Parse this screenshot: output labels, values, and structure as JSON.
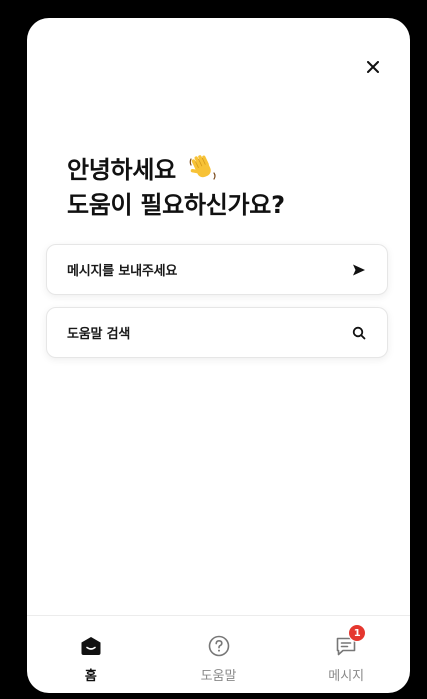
{
  "greeting": {
    "line1": "안녕하세요",
    "line2": "도움이 필요하신가요?",
    "emoji_icon": "waving-hand-icon"
  },
  "actions": {
    "send_message": {
      "label": "메시지를 보내주세요",
      "icon": "send-arrow-icon"
    },
    "search_help": {
      "label": "도움말 검색",
      "icon": "search-icon"
    }
  },
  "close": {
    "icon": "close-icon"
  },
  "nav": {
    "home": {
      "label": "홈",
      "icon": "home-icon",
      "active": true
    },
    "help": {
      "label": "도움말",
      "icon": "help-circle-icon"
    },
    "messages": {
      "label": "메시지",
      "icon": "message-icon",
      "badge": "1"
    }
  },
  "colors": {
    "background": "#000000",
    "panel": "#ffffff",
    "text": "#111111",
    "muted": "#8a8a8a",
    "badge": "#e5372f"
  }
}
